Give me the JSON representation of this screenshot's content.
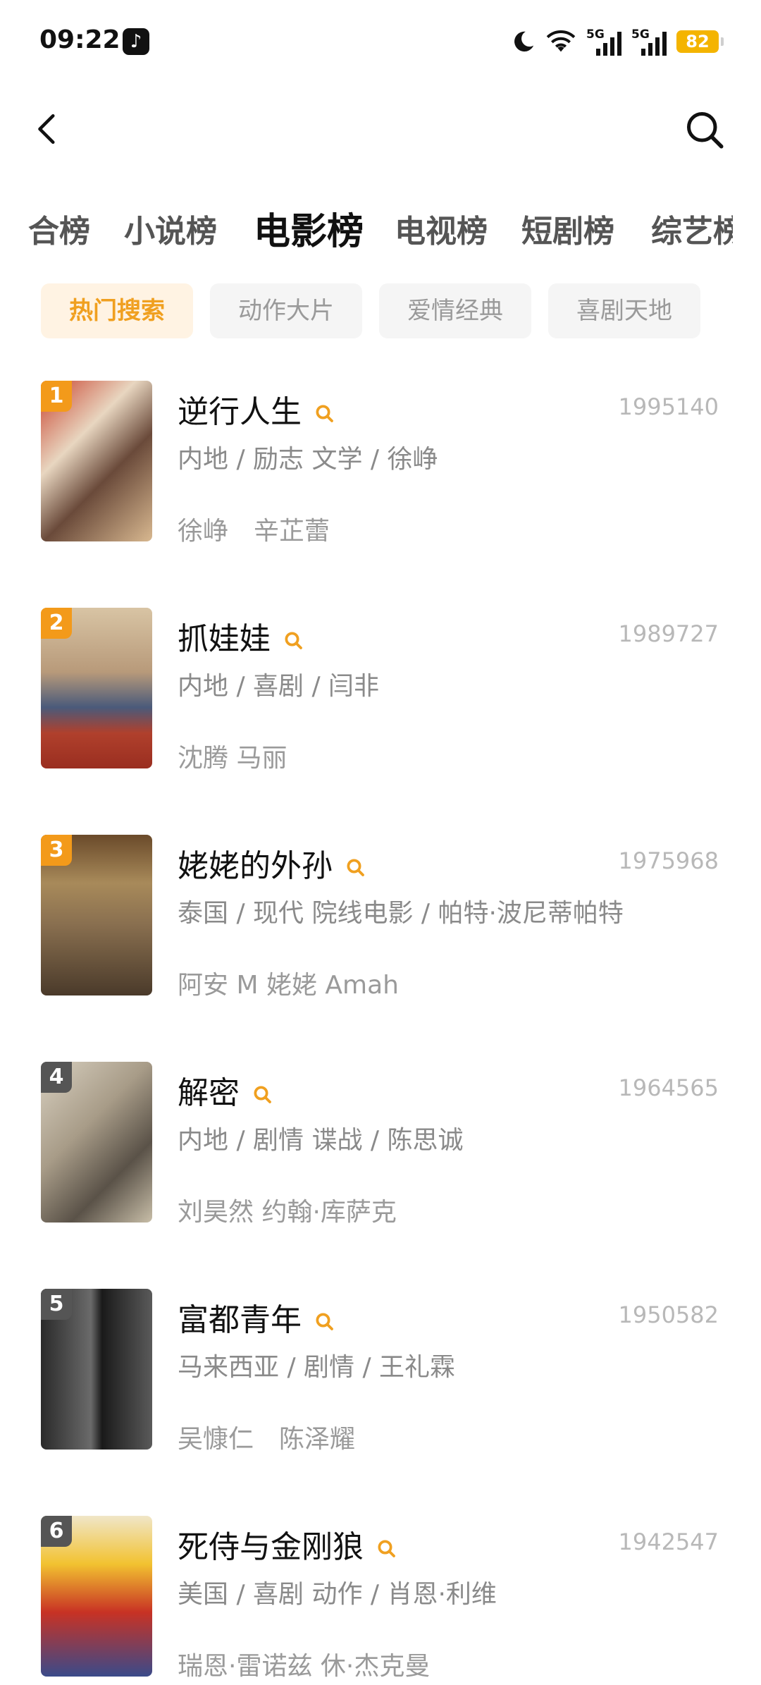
{
  "status_bar": {
    "time": "09:22",
    "tiktok_icon": "♪",
    "battery": "82",
    "net1": "5G",
    "net2": "5G"
  },
  "tabs": [
    "合榜",
    "小说榜",
    "电影榜",
    "电视榜",
    "短剧榜",
    "综艺榜"
  ],
  "chips": [
    "热门搜索",
    "动作大片",
    "爱情经典",
    "喜剧天地"
  ],
  "colors": {
    "accent": "#f0a020",
    "chip_active_bg": "#fff3e3"
  },
  "items": [
    {
      "rank": "1",
      "title": "逆行人生",
      "count": "1995140",
      "meta": "内地 / 励志 文学 / 徐峥",
      "cast": "徐峥　辛芷蕾"
    },
    {
      "rank": "2",
      "title": "抓娃娃",
      "count": "1989727",
      "meta": "内地 / 喜剧 / 闫非",
      "cast": "沈腾 马丽"
    },
    {
      "rank": "3",
      "title": "姥姥的外孙",
      "count": "1975968",
      "meta": "泰国 / 现代 院线电影 / 帕特·波尼蒂帕特",
      "cast": "阿安 M 姥姥 Amah"
    },
    {
      "rank": "4",
      "title": "解密",
      "count": "1964565",
      "meta": "内地 / 剧情 谍战 / 陈思诚",
      "cast": "刘昊然 约翰·库萨克"
    },
    {
      "rank": "5",
      "title": "富都青年",
      "count": "1950582",
      "meta": "马来西亚 / 剧情 / 王礼霖",
      "cast": "吴慷仁　陈泽耀"
    },
    {
      "rank": "6",
      "title": "死侍与金刚狼",
      "count": "1942547",
      "meta": "美国 / 喜剧 动作 / 肖恩·利维",
      "cast": "瑞恩·雷诺兹 休·杰克曼"
    }
  ]
}
